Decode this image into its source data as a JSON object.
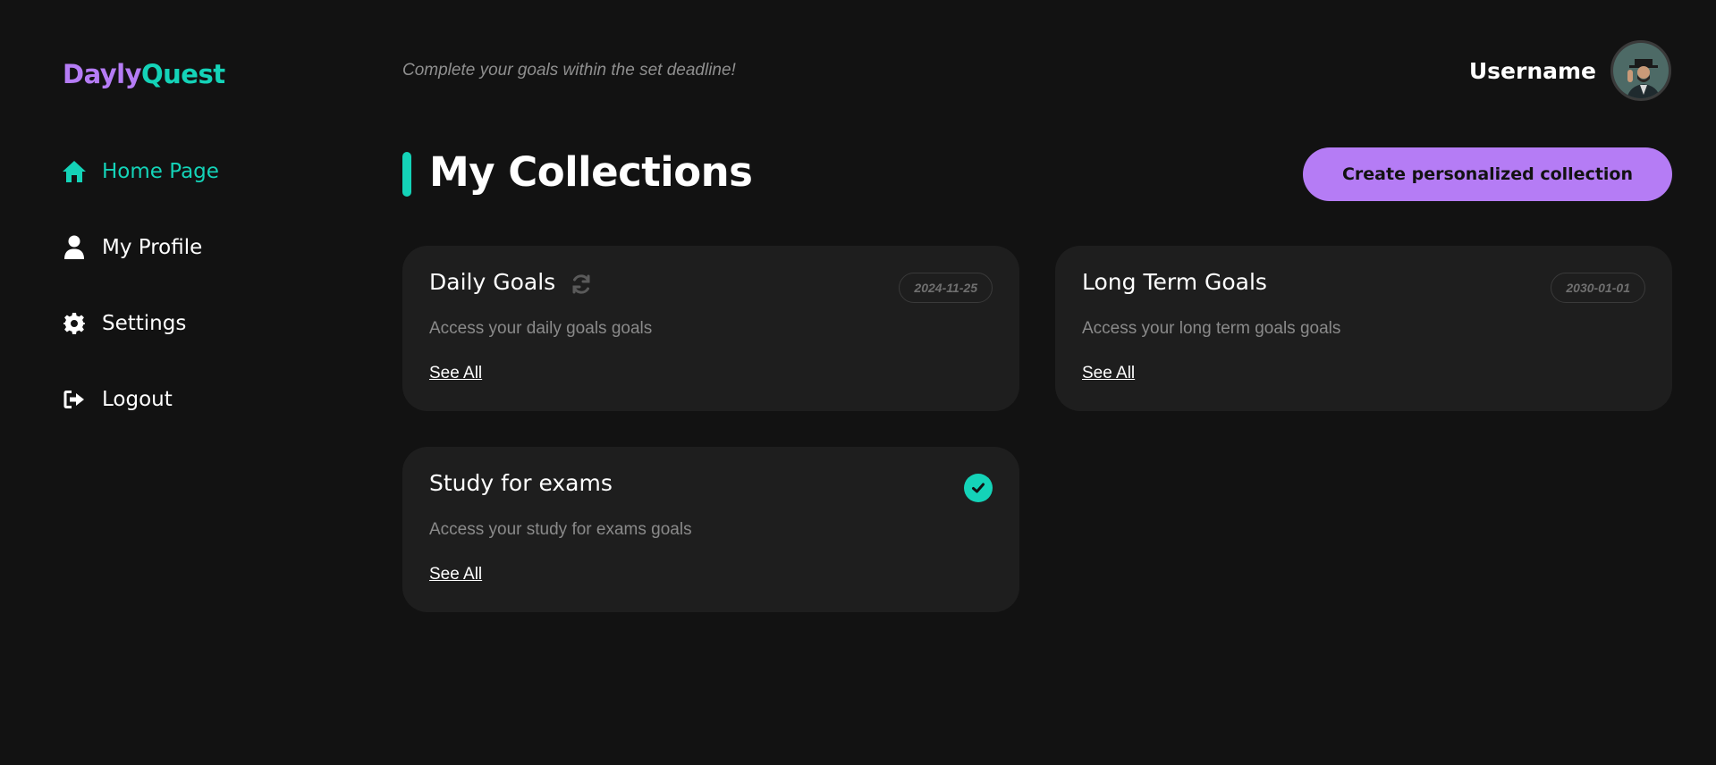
{
  "logo": {
    "part1": "Dayly",
    "part2": "Quest"
  },
  "sidebar": {
    "items": [
      {
        "label": "Home Page",
        "icon": "home-icon",
        "active": true
      },
      {
        "label": "My Profile",
        "icon": "user-icon",
        "active": false
      },
      {
        "label": "Settings",
        "icon": "gear-icon",
        "active": false
      },
      {
        "label": "Logout",
        "icon": "logout-icon",
        "active": false
      }
    ]
  },
  "header": {
    "tagline": "Complete your goals within the set deadline!",
    "username": "Username"
  },
  "main": {
    "title": "My Collections",
    "create_button": "Create personalized collection",
    "collections": [
      {
        "title": "Daily Goals",
        "description": "Access your daily goals goals",
        "link": "See All",
        "date": "2024-11-25",
        "status_icon": "refresh-icon"
      },
      {
        "title": "Long Term Goals",
        "description": "Access your long term goals goals",
        "link": "See All",
        "date": "2030-01-01",
        "status_icon": ""
      },
      {
        "title": "Study for exams",
        "description": "Access your study for exams goals",
        "link": "See All",
        "date": "",
        "status_icon": "check-circle-icon"
      }
    ]
  },
  "colors": {
    "background": "#121212",
    "card": "#1e1e1e",
    "accent_teal": "#14d3b8",
    "accent_purple": "#b57cf5"
  }
}
